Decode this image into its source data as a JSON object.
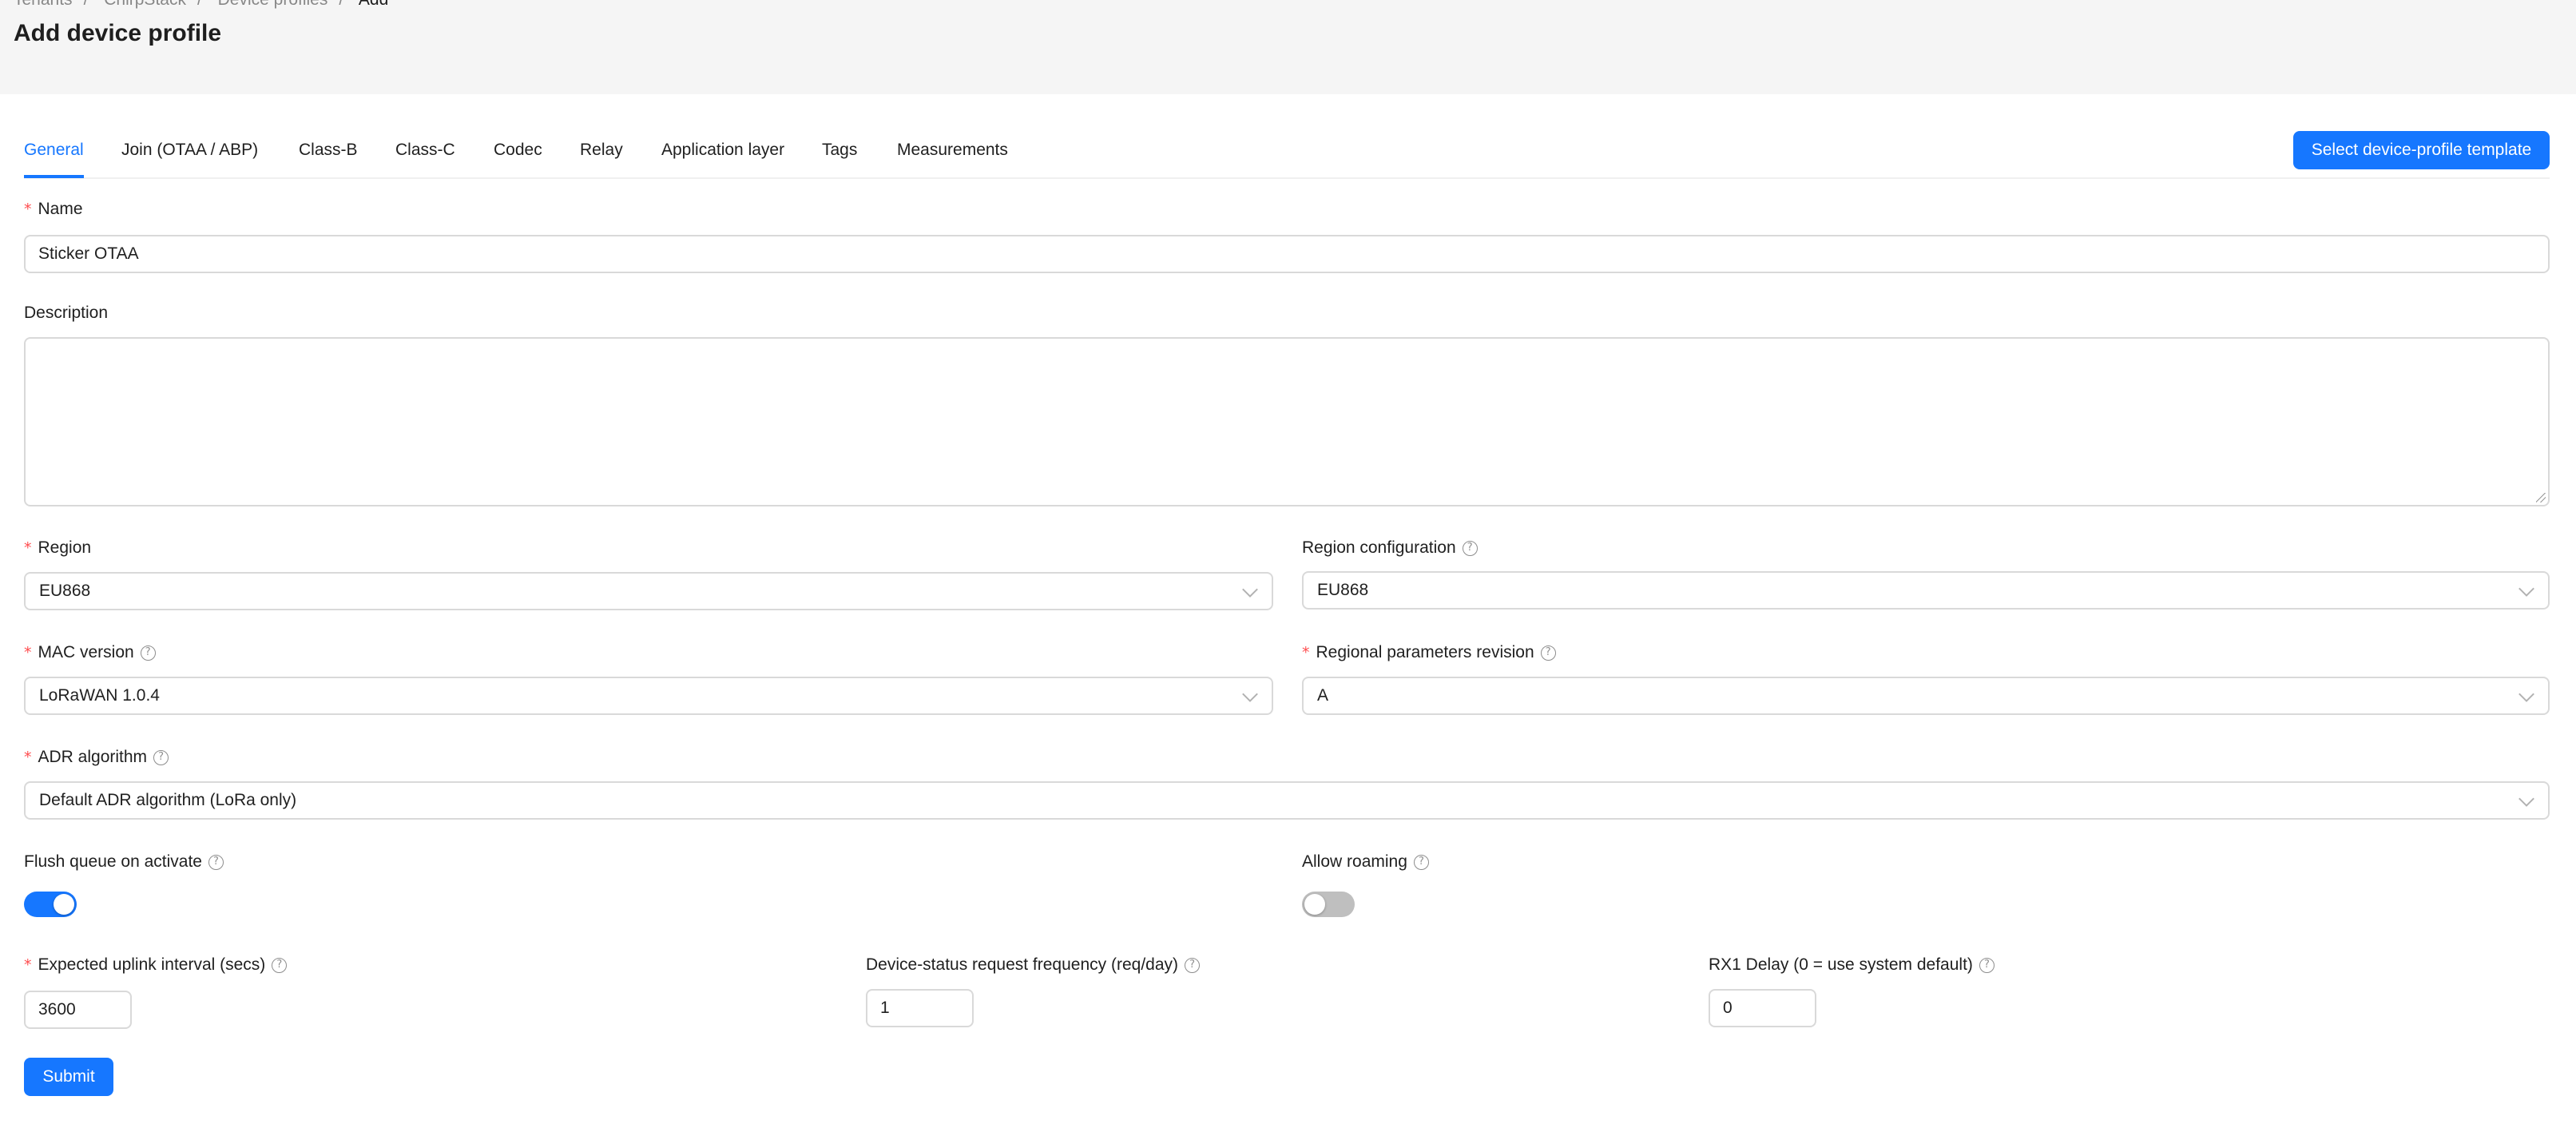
{
  "header": {
    "breadcrumb": [
      "Tenants",
      "ChirpStack",
      "Device profiles",
      "Add"
    ],
    "title": "Add device profile"
  },
  "tabs": [
    "General",
    "Join (OTAA / ABP)",
    "Class-B",
    "Class-C",
    "Codec",
    "Relay",
    "Application layer",
    "Tags",
    "Measurements"
  ],
  "active_tab": "General",
  "template_button": "Select device-profile template",
  "form": {
    "name": {
      "label": "Name",
      "value": "Sticker OTAA"
    },
    "description": {
      "label": "Description",
      "value": ""
    },
    "region": {
      "label": "Region",
      "value": "EU868"
    },
    "region_config": {
      "label": "Region configuration",
      "value": "EU868"
    },
    "mac_version": {
      "label": "MAC version",
      "value": "LoRaWAN 1.0.4"
    },
    "rp_revision": {
      "label": "Regional parameters revision",
      "value": "A"
    },
    "adr": {
      "label": "ADR algorithm",
      "value": "Default ADR algorithm (LoRa only)"
    },
    "flush_queue": {
      "label": "Flush queue on activate",
      "checked": true
    },
    "allow_roaming": {
      "label": "Allow roaming",
      "checked": false
    },
    "uplink_interval": {
      "label": "Expected uplink interval (secs)",
      "value": "3600"
    },
    "status_freq": {
      "label": "Device-status request frequency (req/day)",
      "value": "1"
    },
    "rx1_delay": {
      "label": "RX1 Delay (0 = use system default)",
      "value": "0"
    }
  },
  "submit_label": "Submit",
  "icons": {
    "help": "question-circle-icon",
    "dropdown": "chevron-down-icon"
  },
  "colors": {
    "primary": "#1677ff",
    "required": "#ff4d4f"
  }
}
